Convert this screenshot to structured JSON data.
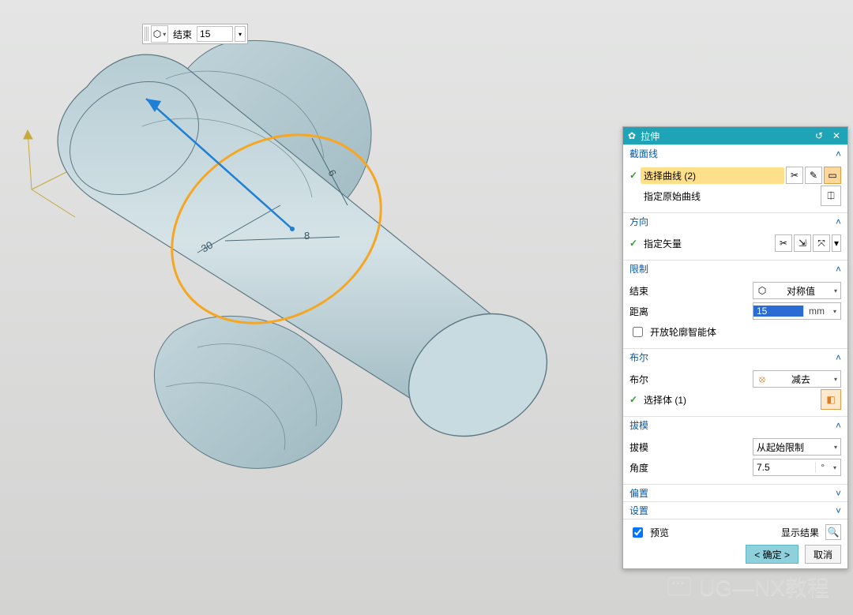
{
  "floating": {
    "label": "结束",
    "value": "15"
  },
  "panel": {
    "title": "拉伸",
    "sections": {
      "section_curve": {
        "header": "截面线",
        "select_curve_label": "选择曲线 (2)",
        "specify_original_label": "指定原始曲线"
      },
      "direction": {
        "header": "方向",
        "specify_vector_label": "指定矢量"
      },
      "limits": {
        "header": "限制",
        "end_label": "结束",
        "end_value": "对称值",
        "distance_label": "距离",
        "distance_value": "15",
        "distance_unit": "mm",
        "open_smart_label": "开放轮廓智能体"
      },
      "boolean": {
        "header": "布尔",
        "bool_label": "布尔",
        "bool_value": "减去",
        "select_body_label": "选择体 (1)"
      },
      "draft": {
        "header": "拔模",
        "draft_label": "拔模",
        "draft_value": "从起始限制",
        "angle_label": "角度",
        "angle_value": "7.5",
        "angle_unit": "°"
      },
      "offset": {
        "header": "偏置"
      },
      "settings": {
        "header": "设置"
      }
    },
    "footer": {
      "preview_label": "预览",
      "show_result_label": "显示结果",
      "ok_label": "< 确定 >",
      "cancel_label": "取消"
    }
  },
  "icons": {
    "gear": "✿",
    "cube": "⬡",
    "reset": "↺",
    "close": "✕",
    "scissors": "✂",
    "sketch": "✎",
    "rect": "▭",
    "axis1": "⇲",
    "axis2": "⤧",
    "body": "◧",
    "mag": "🔍"
  },
  "dims": {
    "d1": "8",
    "d2": "6",
    "d3": "30"
  },
  "watermark": "UG—NX教程"
}
